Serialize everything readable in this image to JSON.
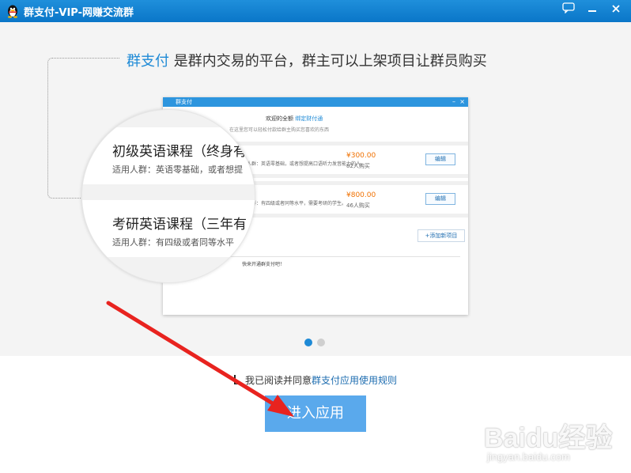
{
  "window": {
    "title": "群支付-VIP-网赚交流群"
  },
  "intro": {
    "brand": "群支付",
    "description": " 是群内交易的平台，群主可以上架项目让群员购买"
  },
  "preview": {
    "window_title": "群支付",
    "header_text": "欢迎的全额",
    "header_link": "绑定财付通",
    "header_sub": "在这里您可以轻松付款给群主购买您喜欢的东西",
    "items": [
      {
        "title": "初级英语课程（终身有效）",
        "audience": "适用人群：英语零基础，或者想提高口语听力发音能力的人。",
        "price": "¥300.00",
        "buyers": "82人购买",
        "edit": "编辑"
      },
      {
        "title": "考研英语课程（三年有效）",
        "audience": "适用人群：有四级或者同等水平，需要考研的学生。",
        "price": "¥800.00",
        "buyers": "46人购买",
        "edit": "编辑"
      }
    ],
    "add_button": "+添加新项目",
    "footer_text": "快来开通群支付吧！"
  },
  "magnifier": {
    "card1_title": "初级英语课程（终身有",
    "card1_sub": "适用人群：英语零基础，或者想提",
    "card2_title": "考研英语课程（三年有",
    "card2_sub": "适用人群：有四级或者同等水平"
  },
  "carousel": {
    "current_slide": 1,
    "total_slides": 2
  },
  "agreement": {
    "checked": true,
    "text": "我已阅读并同意",
    "link": "群支付应用使用规则"
  },
  "enter_button": "进入应用",
  "watermark": {
    "logo_text": "Baidu经验",
    "url": "jingyan.baidu.com"
  },
  "colors": {
    "accent": "#1e8ad6",
    "button": "#5aa9ec",
    "price": "#f07000",
    "arrow": "#e8231f"
  }
}
